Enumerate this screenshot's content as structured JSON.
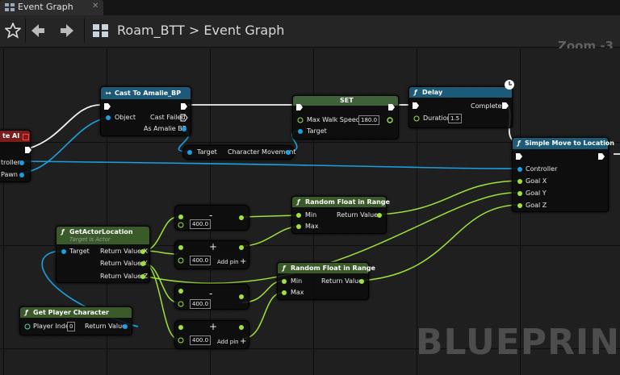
{
  "tab": {
    "title": "Event Graph"
  },
  "breadcrumb": {
    "blueprint": "Roam_BTT",
    "separator": ">",
    "graph": "Event Graph"
  },
  "zoom": "Zoom -3",
  "watermark": "BLUEPRINT",
  "nodes": {
    "partial_event": {
      "title": "te AI",
      "pin_controller": "troller",
      "pin_pawn": "Pawn"
    },
    "cast": {
      "title": "Cast To Amalie_BP",
      "object": "Object",
      "cast_failed": "Cast Failed",
      "as_amalie": "As Amalie BP"
    },
    "set": {
      "title": "SET",
      "max_walk_speed": "Max Walk Speed",
      "max_walk_value": "180.0",
      "target": "Target"
    },
    "delay": {
      "title": "Delay",
      "completed": "Completed",
      "duration": "Duration",
      "duration_value": "1.5"
    },
    "char_movement": {
      "target": "Target",
      "output": "Character Movement"
    },
    "simple_move": {
      "title": "Simple Move to Location",
      "controller": "Controller",
      "goal_x": "Goal X",
      "goal_y": "Goal Y",
      "goal_z": "Goal Z"
    },
    "get_actor_location": {
      "title": "GetActorLocation",
      "subtitle": "Target is Actor",
      "target": "Target",
      "rx": "Return Value X",
      "ry": "Return Value Y",
      "rz": "Return Value Z"
    },
    "random1": {
      "title": "Random Float in Range",
      "min": "Min",
      "max": "Max",
      "return": "Return Value"
    },
    "random2": {
      "title": "Random Float in Range",
      "min": "Min",
      "max": "Max",
      "return": "Return Value"
    },
    "get_player": {
      "title": "Get Player Character",
      "player_index": "Player Index",
      "player_index_value": "0",
      "return": "Return Value"
    },
    "math1": {
      "value": "400.0",
      "op": "-"
    },
    "math2": {
      "value": "400.0",
      "op": "+",
      "add_pin": "Add pin"
    },
    "math3": {
      "value": "400.0",
      "op": "-"
    },
    "math4": {
      "value": "400.0",
      "op": "+",
      "add_pin": "Add pin"
    }
  },
  "colors": {
    "exec": "#ffffff",
    "float": "#9fe23a",
    "object": "#1aa0e0",
    "cast_header": "#1d5a78",
    "func_header": "#3a5a2a",
    "set_header": "#40603a"
  }
}
